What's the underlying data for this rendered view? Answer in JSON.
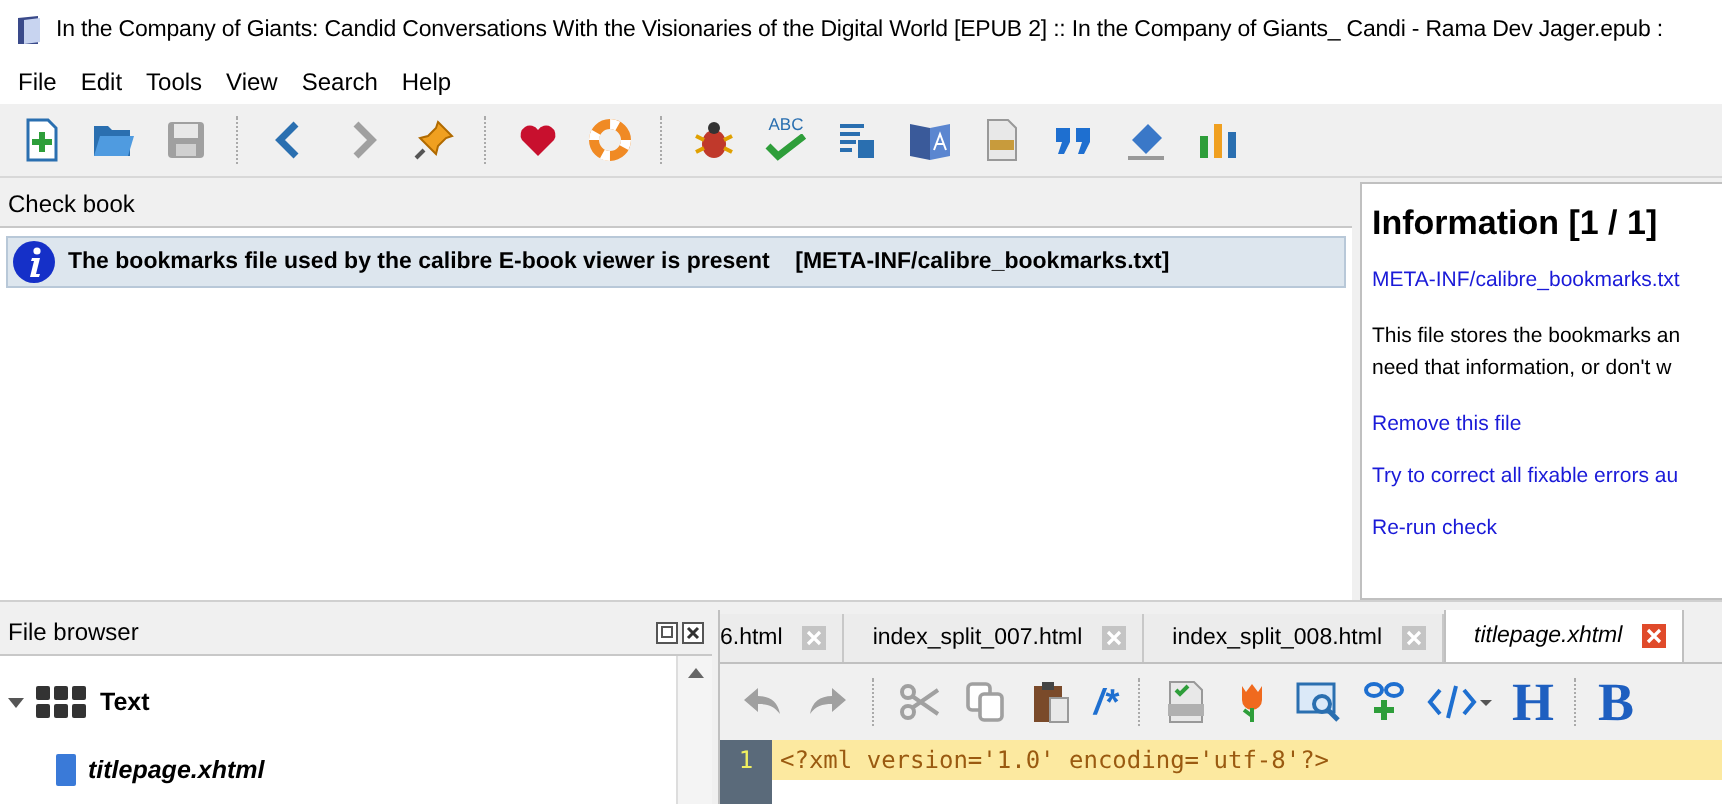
{
  "window": {
    "title": "In the Company of Giants: Candid Conversations With the Visionaries of the Digital World [EPUB 2] :: In the Company of Giants_ Candi - Rama Dev Jager.epub :"
  },
  "menu": [
    "File",
    "Edit",
    "Tools",
    "View",
    "Search",
    "Help"
  ],
  "toolbar": [
    {
      "kind": "new",
      "disabled": false
    },
    {
      "kind": "open",
      "disabled": false
    },
    {
      "kind": "save",
      "disabled": true
    },
    {
      "kind": "sep"
    },
    {
      "kind": "back",
      "disabled": false
    },
    {
      "kind": "forward",
      "disabled": true
    },
    {
      "kind": "pin",
      "disabled": false
    },
    {
      "kind": "sep"
    },
    {
      "kind": "heart",
      "disabled": false
    },
    {
      "kind": "help",
      "disabled": false
    },
    {
      "kind": "sep"
    },
    {
      "kind": "bug",
      "disabled": false
    },
    {
      "kind": "spell",
      "disabled": false,
      "label": "ABC"
    },
    {
      "kind": "reports",
      "disabled": false
    },
    {
      "kind": "translate",
      "disabled": false
    },
    {
      "kind": "font",
      "disabled": false
    },
    {
      "kind": "quote",
      "disabled": false
    },
    {
      "kind": "eraser",
      "disabled": false
    },
    {
      "kind": "stats",
      "disabled": false
    }
  ],
  "check_book": {
    "title": "Check book",
    "items": [
      {
        "kind": "info",
        "message": "The bookmarks file used by the calibre E-book viewer is present",
        "location": "[META-INF/calibre_bookmarks.txt]",
        "selected": true
      }
    ]
  },
  "information": {
    "title": "Information [1 / 1]",
    "file_link": "META-INF/calibre_bookmarks.txt",
    "description_lines": [
      "This file stores the bookmarks an",
      "need that information, or don't w"
    ],
    "actions": [
      "Remove this file",
      "Try to correct all fixable errors au",
      "Re-run check"
    ]
  },
  "file_browser": {
    "title": "File browser",
    "tree": [
      {
        "label": "Text",
        "expanded": true,
        "children": [
          {
            "label": "titlepage.xhtml",
            "selected": true
          }
        ]
      }
    ]
  },
  "editor": {
    "tabs": [
      {
        "label": "6.html",
        "selected": false
      },
      {
        "label": "index_split_007.html",
        "selected": false
      },
      {
        "label": "index_split_008.html",
        "selected": false
      },
      {
        "label": "titlepage.xhtml",
        "selected": true
      }
    ],
    "toolbar": [
      {
        "kind": "undo",
        "disabled": true
      },
      {
        "kind": "redo",
        "disabled": true
      },
      {
        "kind": "sep"
      },
      {
        "kind": "cut",
        "disabled": true
      },
      {
        "kind": "copy",
        "disabled": true
      },
      {
        "kind": "paste",
        "disabled": false
      },
      {
        "kind": "text",
        "text": "/*"
      },
      {
        "kind": "sep"
      },
      {
        "kind": "html",
        "disabled": false
      },
      {
        "kind": "tulip",
        "disabled": false
      },
      {
        "kind": "image",
        "disabled": false
      },
      {
        "kind": "link",
        "disabled": false
      },
      {
        "kind": "tag",
        "disabled": false
      },
      {
        "kind": "textbig",
        "text": "H"
      },
      {
        "kind": "sep"
      },
      {
        "kind": "textbig",
        "text": "B"
      }
    ],
    "lines": [
      {
        "number": "1",
        "code": "<?xml version='1.0' encoding='utf-8'?>",
        "current": true
      }
    ]
  }
}
